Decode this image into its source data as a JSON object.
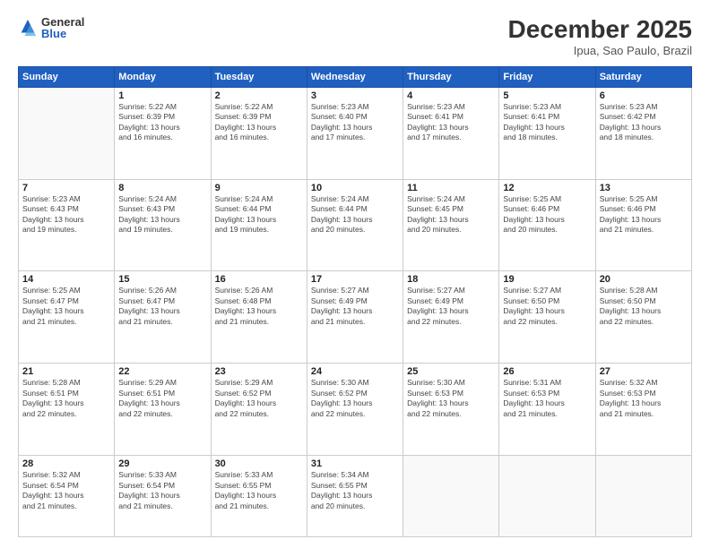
{
  "logo": {
    "general": "General",
    "blue": "Blue"
  },
  "header": {
    "month": "December 2025",
    "location": "Ipua, Sao Paulo, Brazil"
  },
  "weekdays": [
    "Sunday",
    "Monday",
    "Tuesday",
    "Wednesday",
    "Thursday",
    "Friday",
    "Saturday"
  ],
  "weeks": [
    [
      {
        "day": "",
        "info": ""
      },
      {
        "day": "1",
        "info": "Sunrise: 5:22 AM\nSunset: 6:39 PM\nDaylight: 13 hours\nand 16 minutes."
      },
      {
        "day": "2",
        "info": "Sunrise: 5:22 AM\nSunset: 6:39 PM\nDaylight: 13 hours\nand 16 minutes."
      },
      {
        "day": "3",
        "info": "Sunrise: 5:23 AM\nSunset: 6:40 PM\nDaylight: 13 hours\nand 17 minutes."
      },
      {
        "day": "4",
        "info": "Sunrise: 5:23 AM\nSunset: 6:41 PM\nDaylight: 13 hours\nand 17 minutes."
      },
      {
        "day": "5",
        "info": "Sunrise: 5:23 AM\nSunset: 6:41 PM\nDaylight: 13 hours\nand 18 minutes."
      },
      {
        "day": "6",
        "info": "Sunrise: 5:23 AM\nSunset: 6:42 PM\nDaylight: 13 hours\nand 18 minutes."
      }
    ],
    [
      {
        "day": "7",
        "info": "Sunrise: 5:23 AM\nSunset: 6:43 PM\nDaylight: 13 hours\nand 19 minutes."
      },
      {
        "day": "8",
        "info": "Sunrise: 5:24 AM\nSunset: 6:43 PM\nDaylight: 13 hours\nand 19 minutes."
      },
      {
        "day": "9",
        "info": "Sunrise: 5:24 AM\nSunset: 6:44 PM\nDaylight: 13 hours\nand 19 minutes."
      },
      {
        "day": "10",
        "info": "Sunrise: 5:24 AM\nSunset: 6:44 PM\nDaylight: 13 hours\nand 20 minutes."
      },
      {
        "day": "11",
        "info": "Sunrise: 5:24 AM\nSunset: 6:45 PM\nDaylight: 13 hours\nand 20 minutes."
      },
      {
        "day": "12",
        "info": "Sunrise: 5:25 AM\nSunset: 6:46 PM\nDaylight: 13 hours\nand 20 minutes."
      },
      {
        "day": "13",
        "info": "Sunrise: 5:25 AM\nSunset: 6:46 PM\nDaylight: 13 hours\nand 21 minutes."
      }
    ],
    [
      {
        "day": "14",
        "info": "Sunrise: 5:25 AM\nSunset: 6:47 PM\nDaylight: 13 hours\nand 21 minutes."
      },
      {
        "day": "15",
        "info": "Sunrise: 5:26 AM\nSunset: 6:47 PM\nDaylight: 13 hours\nand 21 minutes."
      },
      {
        "day": "16",
        "info": "Sunrise: 5:26 AM\nSunset: 6:48 PM\nDaylight: 13 hours\nand 21 minutes."
      },
      {
        "day": "17",
        "info": "Sunrise: 5:27 AM\nSunset: 6:49 PM\nDaylight: 13 hours\nand 21 minutes."
      },
      {
        "day": "18",
        "info": "Sunrise: 5:27 AM\nSunset: 6:49 PM\nDaylight: 13 hours\nand 22 minutes."
      },
      {
        "day": "19",
        "info": "Sunrise: 5:27 AM\nSunset: 6:50 PM\nDaylight: 13 hours\nand 22 minutes."
      },
      {
        "day": "20",
        "info": "Sunrise: 5:28 AM\nSunset: 6:50 PM\nDaylight: 13 hours\nand 22 minutes."
      }
    ],
    [
      {
        "day": "21",
        "info": "Sunrise: 5:28 AM\nSunset: 6:51 PM\nDaylight: 13 hours\nand 22 minutes."
      },
      {
        "day": "22",
        "info": "Sunrise: 5:29 AM\nSunset: 6:51 PM\nDaylight: 13 hours\nand 22 minutes."
      },
      {
        "day": "23",
        "info": "Sunrise: 5:29 AM\nSunset: 6:52 PM\nDaylight: 13 hours\nand 22 minutes."
      },
      {
        "day": "24",
        "info": "Sunrise: 5:30 AM\nSunset: 6:52 PM\nDaylight: 13 hours\nand 22 minutes."
      },
      {
        "day": "25",
        "info": "Sunrise: 5:30 AM\nSunset: 6:53 PM\nDaylight: 13 hours\nand 22 minutes."
      },
      {
        "day": "26",
        "info": "Sunrise: 5:31 AM\nSunset: 6:53 PM\nDaylight: 13 hours\nand 21 minutes."
      },
      {
        "day": "27",
        "info": "Sunrise: 5:32 AM\nSunset: 6:53 PM\nDaylight: 13 hours\nand 21 minutes."
      }
    ],
    [
      {
        "day": "28",
        "info": "Sunrise: 5:32 AM\nSunset: 6:54 PM\nDaylight: 13 hours\nand 21 minutes."
      },
      {
        "day": "29",
        "info": "Sunrise: 5:33 AM\nSunset: 6:54 PM\nDaylight: 13 hours\nand 21 minutes."
      },
      {
        "day": "30",
        "info": "Sunrise: 5:33 AM\nSunset: 6:55 PM\nDaylight: 13 hours\nand 21 minutes."
      },
      {
        "day": "31",
        "info": "Sunrise: 5:34 AM\nSunset: 6:55 PM\nDaylight: 13 hours\nand 20 minutes."
      },
      {
        "day": "",
        "info": ""
      },
      {
        "day": "",
        "info": ""
      },
      {
        "day": "",
        "info": ""
      }
    ]
  ]
}
